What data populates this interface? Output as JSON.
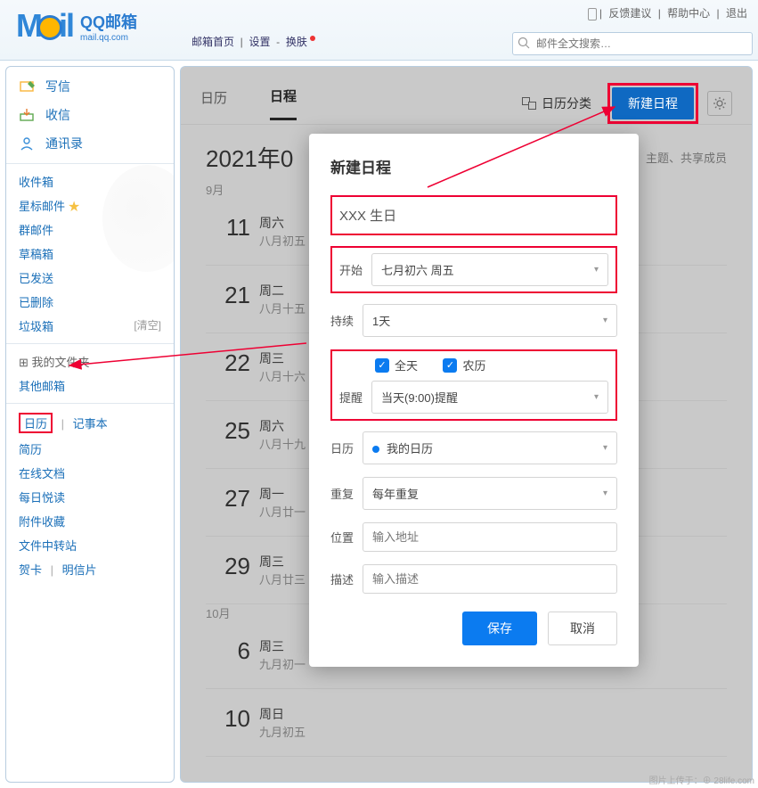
{
  "header": {
    "logo_cn": "QQ邮箱",
    "logo_url": "mail.qq.com",
    "nav_home": "邮箱首页",
    "nav_settings": "设置",
    "nav_skin": "换肤",
    "top_feedback": "反馈建议",
    "top_help": "帮助中心",
    "top_logout": "退出",
    "search_placeholder": "邮件全文搜索…"
  },
  "sidebar": {
    "compose": "写信",
    "receive": "收信",
    "contacts": "通讯录",
    "folders": {
      "inbox": "收件箱",
      "starred": "星标邮件",
      "group": "群邮件",
      "drafts": "草稿箱",
      "sent": "已发送",
      "deleted": "已删除",
      "trash": "垃圾箱",
      "empty_label": "[清空]"
    },
    "my_folders": "我的文件夹",
    "other_mail": "其他邮箱",
    "calendar": "日历",
    "notes": "记事本",
    "resume": "简历",
    "online_doc": "在线文档",
    "daily_read": "每日悦读",
    "attach_fav": "附件收藏",
    "file_transfer": "文件中转站",
    "greeting": "贺卡",
    "postcard": "明信片"
  },
  "calendar": {
    "tab_cal": "日历",
    "tab_schedule": "日程",
    "group_label": "日历分类",
    "new_event_btn": "新建日程",
    "title": "2021年0",
    "hint": "主题、共享成员",
    "month_sep": "9月",
    "month_oct": "10月",
    "events": [
      {
        "day": "11",
        "weekday": "周六",
        "lunar": "八月初五"
      },
      {
        "day": "21",
        "weekday": "周二",
        "lunar": "八月十五"
      },
      {
        "day": "22",
        "weekday": "周三",
        "lunar": "八月十六"
      },
      {
        "day": "25",
        "weekday": "周六",
        "lunar": "八月十九"
      },
      {
        "day": "27",
        "weekday": "周一",
        "lunar": "八月廿一"
      },
      {
        "day": "29",
        "weekday": "周三",
        "lunar": "八月廿三"
      },
      {
        "day": "6",
        "weekday": "周三",
        "lunar": "九月初一"
      },
      {
        "day": "10",
        "weekday": "周日",
        "lunar": "九月初五"
      }
    ]
  },
  "modal": {
    "title": "新建日程",
    "subject": "XXX 生日",
    "start_label": "开始",
    "start_value": "七月初六 周五",
    "duration_label": "持续",
    "duration_value": "1天",
    "allday_label": "全天",
    "lunar_label": "农历",
    "remind_label": "提醒",
    "remind_value": "当天(9:00)提醒",
    "cal_label": "日历",
    "cal_value": "我的日历",
    "repeat_label": "重复",
    "repeat_value": "每年重复",
    "location_label": "位置",
    "location_placeholder": "输入地址",
    "desc_label": "描述",
    "desc_placeholder": "输入描述",
    "save": "保存",
    "cancel": "取消"
  },
  "watermark": "图片上传于：⊕ 28life.com"
}
